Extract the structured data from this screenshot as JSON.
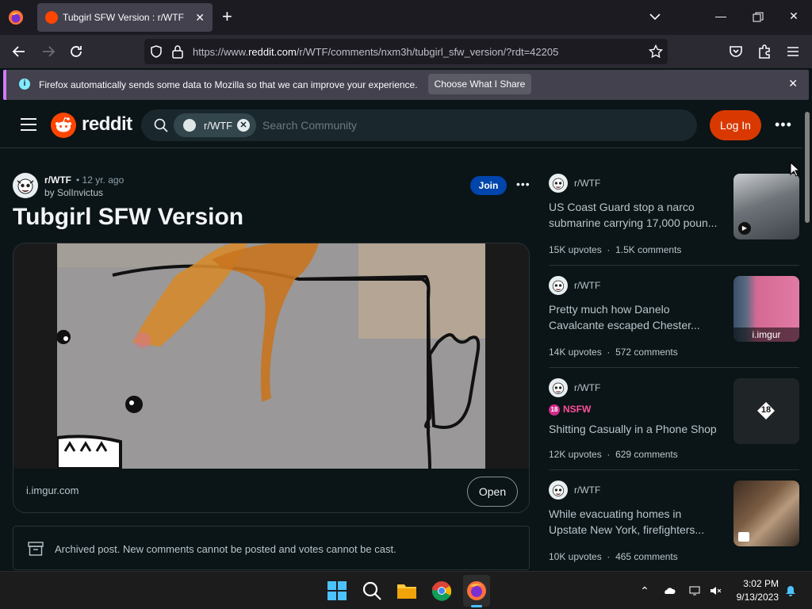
{
  "browser": {
    "tab_title": "Tubgirl SFW Version : r/WTF",
    "url_prefix": "https://www.",
    "url_domain": "reddit.com",
    "url_path": "/r/WTF/comments/nxm3h/tubgirl_sfw_version/?rdt=42205"
  },
  "notification": {
    "text": "Firefox automatically sends some data to Mozilla so that we can improve your experience.",
    "button": "Choose What I Share"
  },
  "header": {
    "logo_text": "reddit",
    "community_chip": "r/WTF",
    "search_placeholder": "Search Community",
    "login_label": "Log In"
  },
  "post": {
    "subreddit": "r/WTF",
    "age": "• 12 yr. ago",
    "author": "by SolInvictus",
    "join_label": "Join",
    "title": "Tubgirl SFW Version",
    "domain": "i.imgur.com",
    "open_label": "Open",
    "archived_text": "Archived post. New comments cannot be posted and votes cannot be cast."
  },
  "sidebar": [
    {
      "sub": "r/WTF",
      "title": "US Coast Guard stop a narco submarine carrying 17,000 poun...",
      "upvotes": "15K upvotes",
      "comments": "1.5K comments",
      "nsfw": false
    },
    {
      "sub": "r/WTF",
      "title": "Pretty much how Danelo Cavalcante escaped Chester...",
      "upvotes": "14K upvotes",
      "comments": "572 comments",
      "thumb_label": "i.imgur",
      "nsfw": false
    },
    {
      "sub": "r/WTF",
      "nsfw_label": "NSFW",
      "title": "Shitting Casually in a Phone Shop",
      "upvotes": "12K upvotes",
      "comments": "629 comments",
      "thumb_badge": "18",
      "nsfw": true
    },
    {
      "sub": "r/WTF",
      "title": "While evacuating homes in Upstate New York, firefighters...",
      "upvotes": "10K upvotes",
      "comments": "465 comments",
      "nsfw": false
    }
  ],
  "taskbar": {
    "time": "3:02 PM",
    "date": "9/13/2023"
  }
}
